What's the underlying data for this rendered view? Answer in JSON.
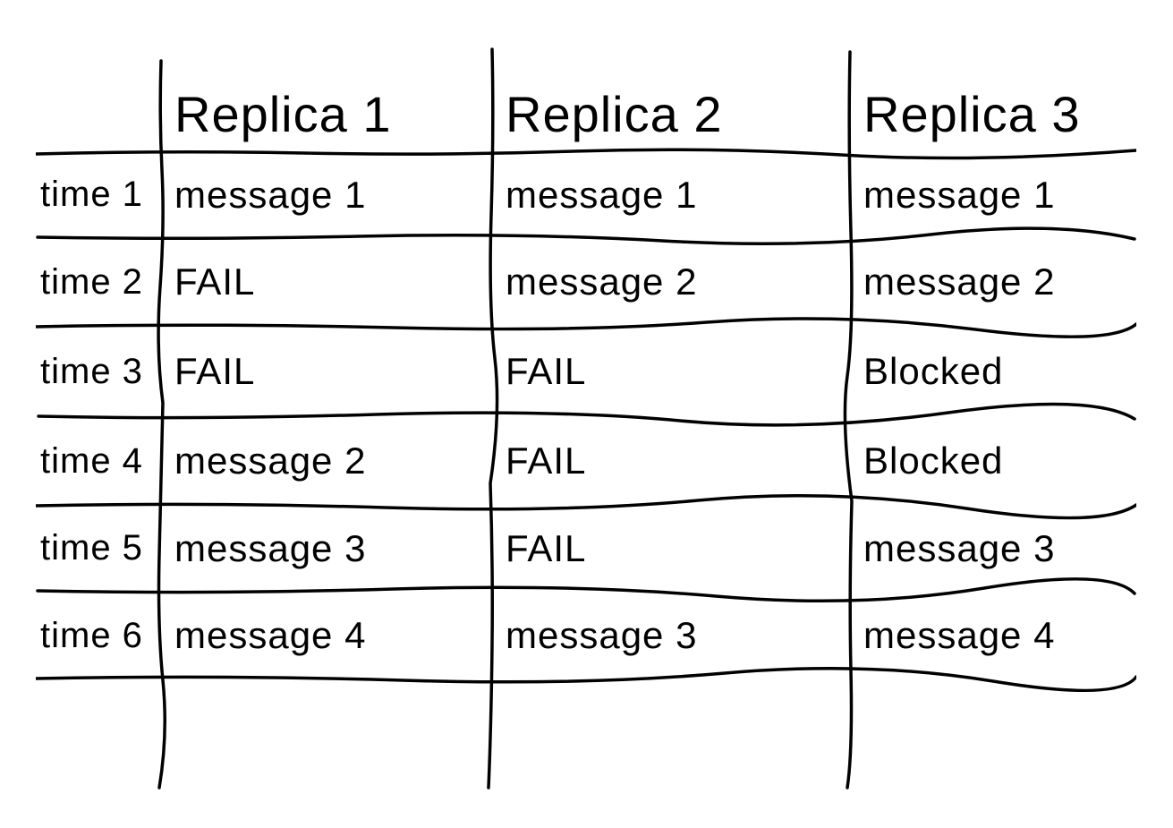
{
  "chart_data": {
    "type": "table",
    "title": "",
    "columns": [
      "",
      "Replica 1",
      "Replica 2",
      "Replica 3"
    ],
    "rows": [
      {
        "label": "time 1",
        "cells": [
          "message 1",
          "message 1",
          "message 1"
        ]
      },
      {
        "label": "time 2",
        "cells": [
          "FAIL",
          "message 2",
          "message 2"
        ]
      },
      {
        "label": "time 3",
        "cells": [
          "FAIL",
          "FAIL",
          "Blocked"
        ]
      },
      {
        "label": "time 4",
        "cells": [
          "message 2",
          "FAIL",
          "Blocked"
        ]
      },
      {
        "label": "time 5",
        "cells": [
          "message 3",
          "FAIL",
          "message 3"
        ]
      },
      {
        "label": "time 6",
        "cells": [
          "message 4",
          "message 3",
          "message 4"
        ]
      }
    ]
  }
}
